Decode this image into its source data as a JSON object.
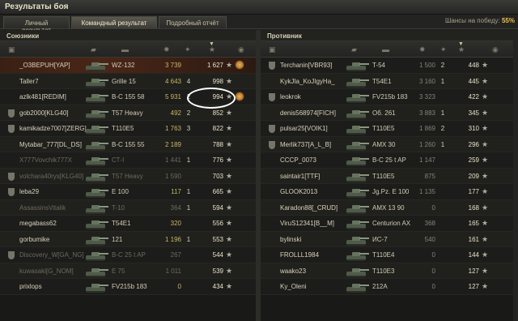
{
  "window": {
    "title": "Результаты боя"
  },
  "tabs": [
    {
      "label": "Личный результат"
    },
    {
      "label": "Командный результат"
    },
    {
      "label": "Подробный отчёт"
    }
  ],
  "win_chance": {
    "label": "Шансы на победу:",
    "value": "55%"
  },
  "allies": {
    "title": "Союзники",
    "rows": [
      {
        "name": "_O3BEPUH[YAP]",
        "tank": "WZ-132",
        "dmg": "3 739",
        "frags": "",
        "xp": "1 627",
        "state": "self",
        "medal": true
      },
      {
        "name": "Taller7",
        "tank": "Grille 15",
        "dmg": "4 643",
        "frags": "4",
        "xp": "998",
        "state": "alive"
      },
      {
        "name": "azlk481[REDIM]",
        "tank": "B-C 155 58",
        "dmg": "5 931",
        "frags": "2",
        "xp": "994",
        "state": "alive",
        "medal": true
      },
      {
        "name": "gob2000[KLG40]",
        "tank": "T57 Heavy",
        "dmg": "492",
        "frags": "2",
        "xp": "852",
        "state": "alive",
        "platoon": true
      },
      {
        "name": "kamikadze7007[ZERG]",
        "tank": "T110E5",
        "dmg": "1 763",
        "frags": "3",
        "xp": "822",
        "state": "alive",
        "platoon": true
      },
      {
        "name": "Mytabar_777[DL_DS]",
        "tank": "B-C 155 55",
        "dmg": "2 189",
        "frags": "",
        "xp": "788",
        "state": "alive"
      },
      {
        "name": "X777Vovchik777X",
        "tank": "СТ-I",
        "dmg": "1 441",
        "frags": "1",
        "xp": "776",
        "state": "dead"
      },
      {
        "name": "volchara40rys[KLG40]",
        "tank": "T57 Heavy",
        "dmg": "1 590",
        "frags": "",
        "xp": "703",
        "state": "dead",
        "platoon": true
      },
      {
        "name": "leba29",
        "tank": "E 100",
        "dmg": "117",
        "frags": "1",
        "xp": "665",
        "state": "alive",
        "platoon": true
      },
      {
        "name": "AssassinsVitalik",
        "tank": "T-10",
        "dmg": "364",
        "frags": "1",
        "xp": "594",
        "state": "dead"
      },
      {
        "name": "megabass62",
        "tank": "T54E1",
        "dmg": "320",
        "frags": "",
        "xp": "556",
        "state": "alive"
      },
      {
        "name": "gorbumike",
        "tank": "121",
        "dmg": "1 196",
        "frags": "1",
        "xp": "553",
        "state": "alive"
      },
      {
        "name": "Discovery_W[GA_NG]",
        "tank": "B-C 25 t AP",
        "dmg": "267",
        "frags": "",
        "xp": "544",
        "state": "dead",
        "platoon": true
      },
      {
        "name": "kuwasaki[G_NOM]",
        "tank": "E 75",
        "dmg": "1 011",
        "frags": "",
        "xp": "539",
        "state": "dead"
      },
      {
        "name": "prixlops",
        "tank": "FV215b 183",
        "dmg": "0",
        "frags": "",
        "xp": "434",
        "state": "alive"
      }
    ]
  },
  "enemies": {
    "title": "Противник",
    "rows": [
      {
        "name": "Terchanin[VBR93]",
        "tank": "T-54",
        "dmg": "1 500",
        "frags": "2",
        "xp": "448",
        "platoon": true
      },
      {
        "name": "KykJIa_KoJIgyHa_",
        "tank": "T54E1",
        "dmg": "3 160",
        "frags": "1",
        "xp": "445"
      },
      {
        "name": "leokrok",
        "tank": "FV215b 183",
        "dmg": "3 323",
        "frags": "",
        "xp": "422",
        "platoon": true
      },
      {
        "name": "denis568974[FICH]",
        "tank": "Об. 261",
        "dmg": "3 883",
        "frags": "1",
        "xp": "345"
      },
      {
        "name": "pulsar25[VOIK1]",
        "tank": "T110E5",
        "dmg": "1 869",
        "frags": "2",
        "xp": "310",
        "platoon": true
      },
      {
        "name": "Merlik737[A_L_B]",
        "tank": "AMX 30",
        "dmg": "1 260",
        "frags": "1",
        "xp": "296",
        "platoon": true
      },
      {
        "name": "CCCP_0073",
        "tank": "B-C 25 t AP",
        "dmg": "1 147",
        "frags": "",
        "xp": "259"
      },
      {
        "name": "saintair1[TTF]",
        "tank": "T110E5",
        "dmg": "875",
        "frags": "",
        "xp": "209"
      },
      {
        "name": "GLOOK2013",
        "tank": "Jg.Pz. E 100",
        "dmg": "1 135",
        "frags": "",
        "xp": "177"
      },
      {
        "name": "Karadon88[_CRUD]",
        "tank": "AMX 13 90",
        "dmg": "0",
        "frags": "",
        "xp": "168"
      },
      {
        "name": "ViruS12341[B__M]",
        "tank": "Centurion AX",
        "dmg": "368",
        "frags": "",
        "xp": "165"
      },
      {
        "name": "bylinski",
        "tank": "ИС-7",
        "dmg": "540",
        "frags": "",
        "xp": "161"
      },
      {
        "name": "FROLLL1984",
        "tank": "T110E4",
        "dmg": "0",
        "frags": "",
        "xp": "144"
      },
      {
        "name": "waako23",
        "tank": "T110E3",
        "dmg": "0",
        "frags": "",
        "xp": "127"
      },
      {
        "name": "Ky_Oleni",
        "tank": "212A",
        "dmg": "0",
        "frags": "",
        "xp": "127"
      }
    ]
  },
  "colors": {
    "accent": "#f3c14a",
    "self_row": "#4a2617",
    "damage": "#c9b860"
  }
}
